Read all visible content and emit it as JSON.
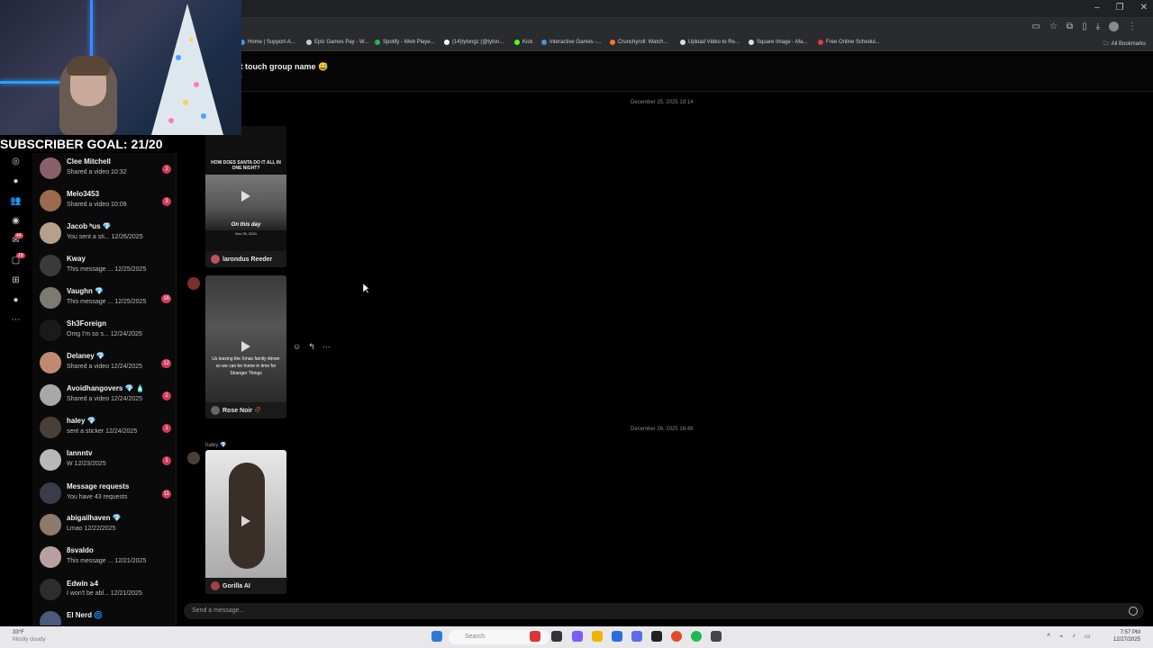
{
  "browser": {
    "window_controls": [
      "–",
      "❐",
      "✕"
    ],
    "bookmarks": [
      {
        "label": "Home | Support-A...",
        "color": "#4a90e2"
      },
      {
        "label": "Epic Games Pay - W...",
        "color": "#cccccc"
      },
      {
        "label": "Spotify - Web Playe...",
        "color": "#1db954"
      },
      {
        "label": "(14)tylongz (@tylon...",
        "color": "#ffffff"
      },
      {
        "label": "Kick",
        "color": "#53fc18"
      },
      {
        "label": "Interactive Games -...",
        "color": "#4a90e2"
      },
      {
        "label": "Crunchyroll: Watch...",
        "color": "#f47521"
      },
      {
        "label": "Upload Video to Re...",
        "color": "#dddddd"
      },
      {
        "label": "Square Image - Ma...",
        "color": "#dddddd"
      },
      {
        "label": "Free Online Schedul...",
        "color": "#e53935"
      }
    ],
    "all_bookmarks": "All Bookmarks"
  },
  "chat": {
    "group_name": "nt touch group name 😅",
    "group_sub": "rs",
    "date_1": "December 25, 2025 19:14",
    "date_2": "December 26, 2025 16:49",
    "composer_placeholder": "Send a message..."
  },
  "messages": [
    {
      "caption": "HOW DOES SANTA DO IT ALL IN ONE NIGHT?",
      "overlay": "On this day",
      "overlay_date": "Dec 25, 2024",
      "author": "larondus Reeder"
    },
    {
      "caption": "Us leaving the Xmas family dinner so we can be home in time for Stranger Things",
      "author": "Rose Noir 🥀"
    },
    {
      "sender": "haley 💎",
      "author": "Gorilla AI"
    }
  ],
  "conversations": [
    {
      "name": "Clee Mitchell",
      "preview": "Shared a video 10:32",
      "badge": "1",
      "color": "#8a5f6a"
    },
    {
      "name": "Melo3453",
      "preview": "Shared a video 10:09",
      "badge": "3",
      "color": "#9c6b4e"
    },
    {
      "name": "Jacob ʰus 💎",
      "preview": "You sent a sti... 12/26/2025",
      "badge": "",
      "color": "#b5a18a"
    },
    {
      "name": "Kway",
      "preview": "This message ... 12/25/2025",
      "badge": "",
      "color": "#3a3a3a"
    },
    {
      "name": "Vaughn 💎",
      "preview": "This message ... 12/25/2025",
      "badge": "16",
      "color": "#7c7a73"
    },
    {
      "name": "Sh3Foreign",
      "preview": "Omg I'm so s... 12/24/2025",
      "badge": "",
      "color": "#1a1a1a"
    },
    {
      "name": "Delaney 💎",
      "preview": "Shared a video 12/24/2025",
      "badge": "12",
      "color": "#c08a72"
    },
    {
      "name": "Avoidhangovers 💎 🧴",
      "preview": "Shared a video 12/24/2025",
      "badge": "2",
      "color": "#a8a8a8"
    },
    {
      "name": "haley 💎",
      "preview": "sent a sticker 12/24/2025",
      "badge": "1",
      "color": "#4a3e36"
    },
    {
      "name": "lannntv",
      "preview": "W 12/23/2025",
      "badge": "1",
      "color": "#b8b8b8"
    },
    {
      "name": "Message requests",
      "preview": "You have 43 requests",
      "badge": "11",
      "color": "#3b3b4a"
    },
    {
      "name": "abigailhaven 💎",
      "preview": "Lmao 12/22/2025",
      "badge": "",
      "color": "#8c7a6a"
    },
    {
      "name": "8svaldo",
      "preview": "This message ... 12/21/2025",
      "badge": "",
      "color": "#b8a0a0"
    },
    {
      "name": "Edwin ঌ4",
      "preview": "I won't be abl... 12/21/2025",
      "badge": "",
      "color": "#2d2d2d"
    },
    {
      "name": "El Nerd 🌀",
      "preview": "",
      "badge": "",
      "color": "#4a5a7a"
    }
  ],
  "rail": {
    "badge_inbox": "44",
    "badge_msgs": "19"
  },
  "overlay": {
    "subscriber_goal": "SUBSCRIBER GOAL: 21/20"
  },
  "taskbar": {
    "weather_temp": "33°F",
    "weather_desc": "Mostly cloudy",
    "search_label": "Search",
    "time": "7:57 PM",
    "date": "12/27/2025"
  }
}
